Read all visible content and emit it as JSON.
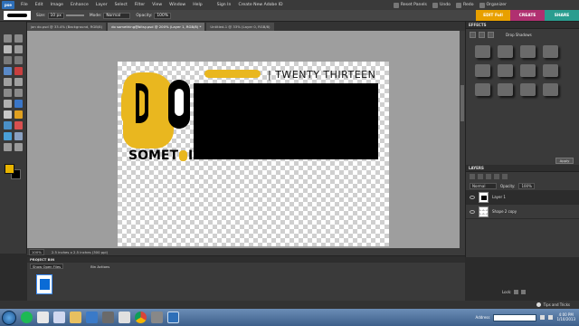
{
  "menu": {
    "logo": "pse",
    "items": [
      "File",
      "Edit",
      "Image",
      "Enhance",
      "Layer",
      "Select",
      "Filter",
      "View",
      "Window",
      "Help"
    ],
    "signin": "Sign In",
    "create_id": "Create New Adobe ID",
    "right": {
      "reset": "Reset Panels",
      "undo": "Undo",
      "redo": "Redo",
      "organizer": "Organizer"
    }
  },
  "options": {
    "size_label": "Size:",
    "size_value": "10 px",
    "mode_label": "Mode:",
    "mode_value": "Normal",
    "opacity_label": "Opacity:",
    "opacity_value": "100%"
  },
  "modes": {
    "edit": "EDIT Full",
    "create": "CREATE",
    "share": "SHARE"
  },
  "doc_tabs": [
    "jan do.psd @ 33.4% (Background, RGB/8)",
    "do something@bitsy.psd @ 200% (Layer 1, RGB/8) *",
    "Untitled-1 @ 33% (Layer 0, RGB/8)"
  ],
  "artwork": {
    "title": "| TWENTY THIRTEEN",
    "bottom_text": "SOMET",
    "bottom_tail": "IN"
  },
  "status": {
    "zoom": "100%",
    "docsize": "2.5 inches x 2.5 inches (300 ppi)"
  },
  "effects": {
    "title": "EFFECTS",
    "dropdown": "Drop Shadows",
    "apply": "Apply"
  },
  "layers": {
    "title": "LAYERS",
    "blend": "Normal",
    "opacity_label": "Opacity:",
    "opacity_value": "100%",
    "items": [
      {
        "name": "Layer 1"
      },
      {
        "name": "Shape 2 copy"
      }
    ],
    "lock_label": "Lock:"
  },
  "project_bin": {
    "title": "PROJECT BIN",
    "show": "Show Open Files",
    "actions": "Bin Actions"
  },
  "bottom": {
    "tips": "Tips and Tricks"
  },
  "taskbar": {
    "address_label": "Address",
    "time": "4:00 PM",
    "date": "1/10/2013"
  },
  "colors": {
    "accent_yellow": "#e9b71f",
    "edit_orange": "#e8a000",
    "create_pink": "#b03070",
    "share_teal": "#2a9d8f"
  }
}
